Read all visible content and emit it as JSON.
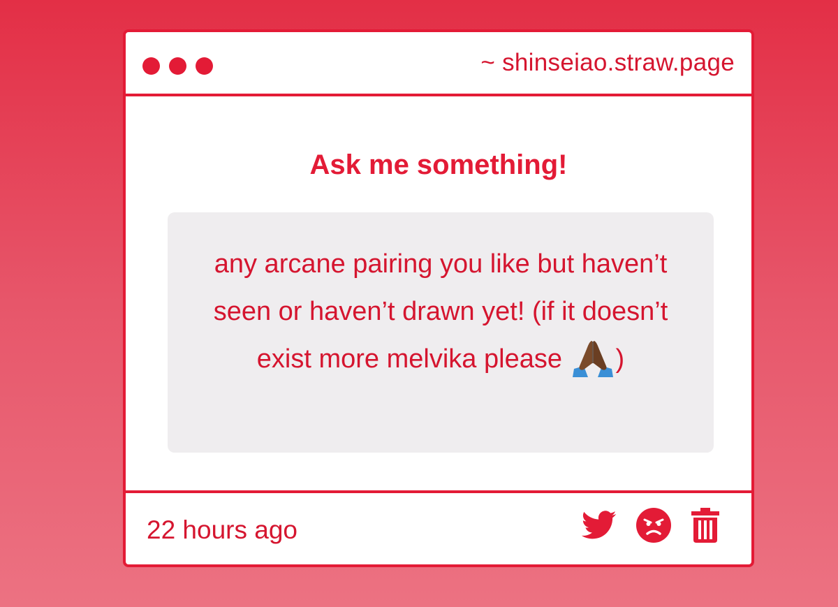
{
  "window": {
    "url": "~ shinseiao.straw.page",
    "dots": [
      "dot",
      "dot",
      "dot"
    ]
  },
  "content": {
    "heading": "Ask me something!",
    "question_before_emoji": "any arcane pairing you like but haven’t seen or haven’t drawn yet! (if it doesn’t exist more melvika please",
    "question_emoji": "folded-hands-icon",
    "question_after_emoji": ")"
  },
  "footer": {
    "timestamp": "22 hours ago",
    "actions": [
      {
        "name": "twitter-share-icon"
      },
      {
        "name": "angry-face-icon"
      },
      {
        "name": "trash-icon"
      }
    ]
  },
  "colors": {
    "accent": "#e31b36",
    "text": "#d5152f",
    "question_bg": "#efedef",
    "background_top": "#e32f46",
    "background_bottom": "#ec7282"
  }
}
